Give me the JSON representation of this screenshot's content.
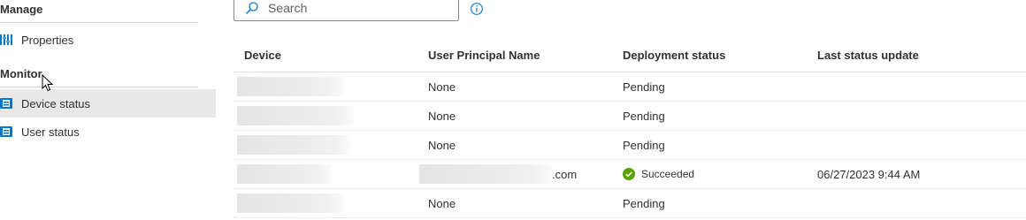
{
  "sidebar": {
    "manage_header": "Manage",
    "manage_items": [
      {
        "label": "Properties",
        "icon": "properties-icon"
      }
    ],
    "monitor_header": "Monitor",
    "monitor_items": [
      {
        "label": "Device status",
        "icon": "device-status-icon",
        "selected": true
      },
      {
        "label": "User status",
        "icon": "user-status-icon",
        "selected": false
      }
    ]
  },
  "search": {
    "placeholder": "Search"
  },
  "table": {
    "columns": [
      "Device",
      "User Principal Name",
      "Deployment status",
      "Last status update"
    ],
    "rows": [
      {
        "device": "",
        "upn": "None",
        "status": "Pending",
        "last_update": ""
      },
      {
        "device": "",
        "upn": "None",
        "status": "Pending",
        "last_update": ""
      },
      {
        "device": "",
        "upn": "None",
        "status": "Pending",
        "last_update": ""
      },
      {
        "device": "",
        "upn": ".com",
        "status": "Succeeded",
        "last_update": "06/27/2023 9:44 AM"
      },
      {
        "device": "",
        "upn": "None",
        "status": "Pending",
        "last_update": ""
      }
    ]
  },
  "colors": {
    "accent": "#0078d4",
    "success": "#57a300",
    "selected_bg": "#e8e8e8"
  }
}
